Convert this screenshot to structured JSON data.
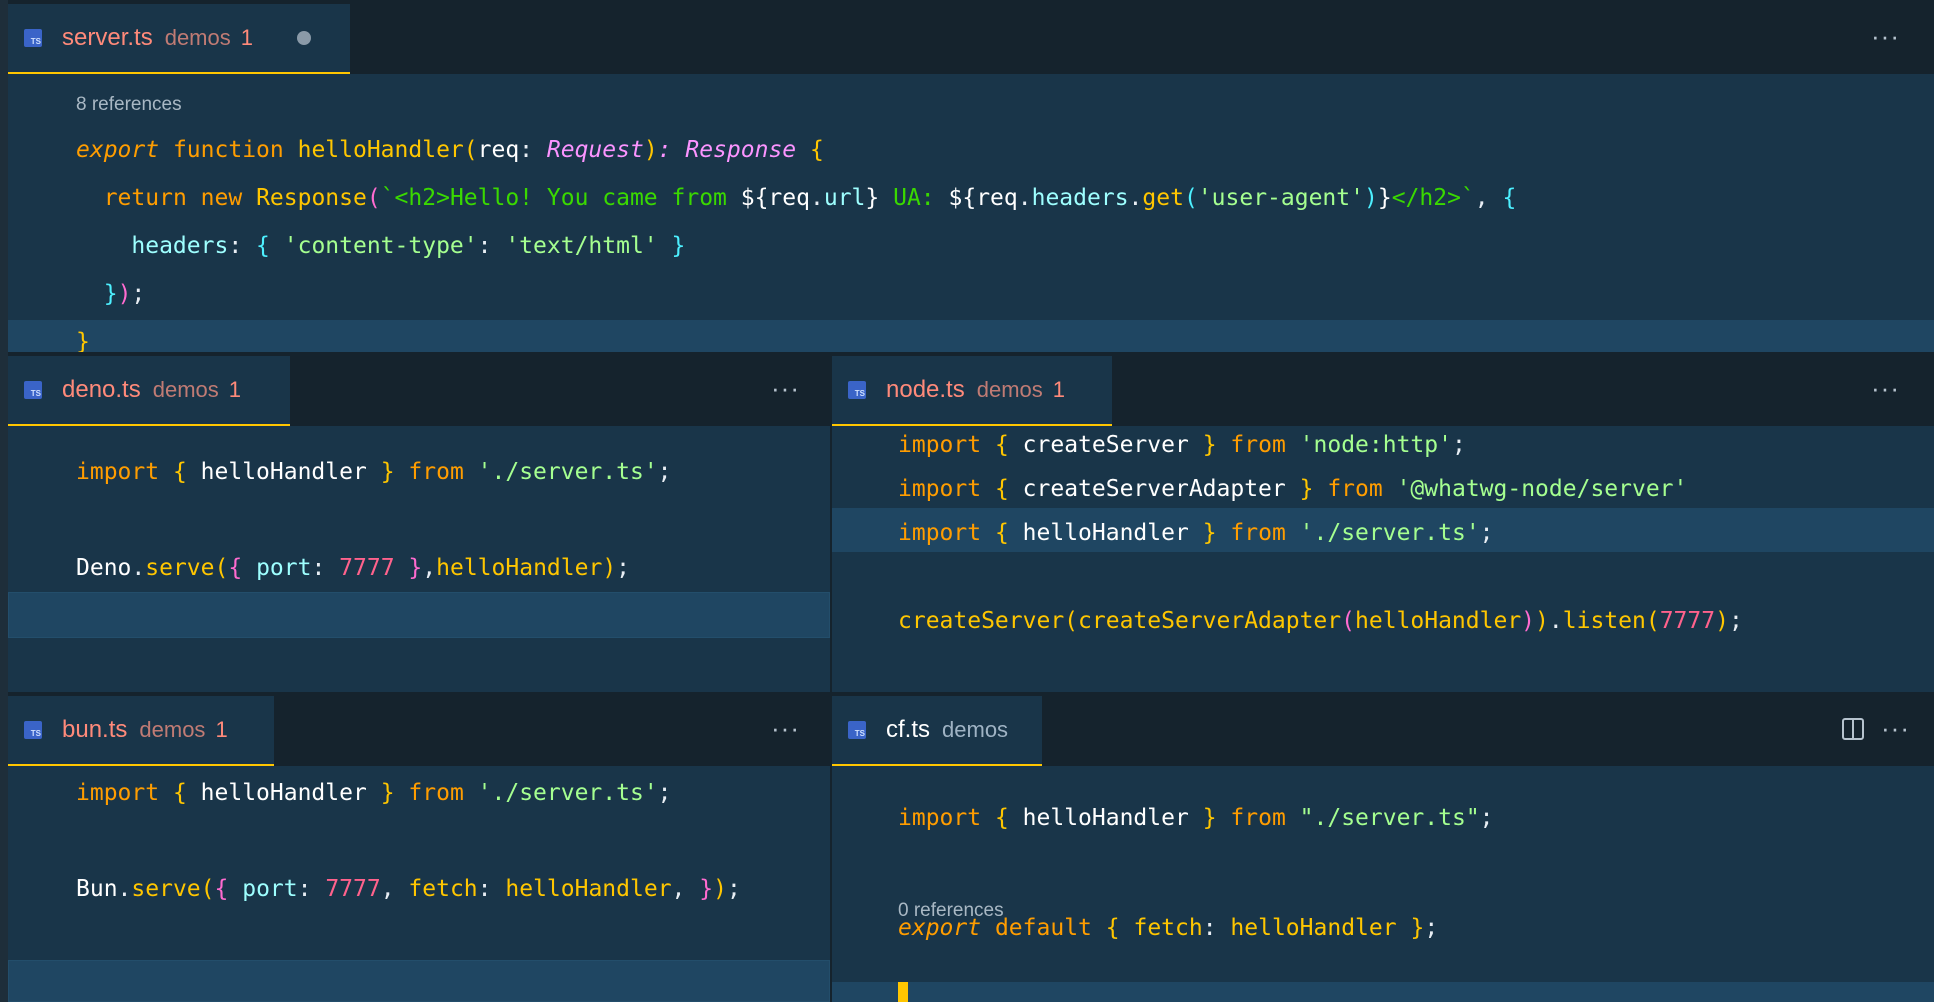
{
  "panes": {
    "server": {
      "tab": {
        "name": "server.ts",
        "folder": "demos",
        "count": "1"
      },
      "ref_top": "8 references",
      "lines": [
        [
          [
            "kwi",
            "export"
          ],
          [
            "plain",
            " "
          ],
          [
            "kw",
            "function"
          ],
          [
            "plain",
            " "
          ],
          [
            "fn",
            "helloHandler"
          ],
          [
            "br",
            "("
          ],
          [
            "plain",
            "req"
          ],
          [
            "punc",
            ": "
          ],
          [
            "ty",
            "Request"
          ],
          [
            "br",
            ")"
          ],
          [
            "ty",
            ": Response"
          ],
          [
            "plain",
            " "
          ],
          [
            "br",
            "{"
          ]
        ],
        [
          [
            "plain",
            "  "
          ],
          [
            "kw",
            "return"
          ],
          [
            "plain",
            " "
          ],
          [
            "kw",
            "new"
          ],
          [
            "plain",
            " "
          ],
          [
            "fn",
            "Response"
          ],
          [
            "br2",
            "("
          ],
          [
            "tpl",
            "`<h2>Hello! You came from "
          ],
          [
            "plain",
            "${req"
          ],
          [
            "punc",
            "."
          ],
          [
            "prop",
            "url"
          ],
          [
            "plain",
            "}"
          ],
          [
            "tpl",
            " UA: "
          ],
          [
            "plain",
            "${req"
          ],
          [
            "punc",
            "."
          ],
          [
            "prop",
            "headers"
          ],
          [
            "punc",
            "."
          ],
          [
            "fn",
            "get"
          ],
          [
            "br3",
            "("
          ],
          [
            "str",
            "'user-agent'"
          ],
          [
            "br3",
            ")"
          ],
          [
            "plain",
            "}"
          ],
          [
            "tpl",
            "</h2>`"
          ],
          [
            "punc",
            ", "
          ],
          [
            "br3",
            "{"
          ]
        ],
        [
          [
            "plain",
            "    "
          ],
          [
            "prop",
            "headers"
          ],
          [
            "punc",
            ": "
          ],
          [
            "br3",
            "{"
          ],
          [
            "plain",
            " "
          ],
          [
            "str",
            "'content-type'"
          ],
          [
            "punc",
            ": "
          ],
          [
            "str",
            "'text/html'"
          ],
          [
            "plain",
            " "
          ],
          [
            "br3",
            "}"
          ]
        ],
        [
          [
            "plain",
            "  "
          ],
          [
            "br3",
            "}"
          ],
          [
            "br2",
            ")"
          ],
          [
            "punc",
            ";"
          ]
        ],
        [
          [
            "br",
            "}"
          ]
        ]
      ]
    },
    "deno": {
      "tab": {
        "name": "deno.ts",
        "folder": "demos",
        "count": "1"
      },
      "lines": [
        [
          [
            "kw",
            "import"
          ],
          [
            "plain",
            " "
          ],
          [
            "br",
            "{"
          ],
          [
            "plain",
            " helloHandler "
          ],
          [
            "br",
            "}"
          ],
          [
            "plain",
            " "
          ],
          [
            "kw",
            "from"
          ],
          [
            "plain",
            " "
          ],
          [
            "str",
            "'./server.ts'"
          ],
          [
            "punc",
            ";"
          ]
        ],
        [],
        [
          [
            "plain",
            "Deno"
          ],
          [
            "punc",
            "."
          ],
          [
            "fn",
            "serve"
          ],
          [
            "br",
            "("
          ],
          [
            "br2",
            "{"
          ],
          [
            "plain",
            " "
          ],
          [
            "prop",
            "port"
          ],
          [
            "punc",
            ": "
          ],
          [
            "num",
            "7777"
          ],
          [
            "plain",
            " "
          ],
          [
            "br2",
            "}"
          ],
          [
            "punc",
            ","
          ],
          [
            "fn",
            "helloHandler"
          ],
          [
            "br",
            ")"
          ],
          [
            "punc",
            ";"
          ]
        ]
      ]
    },
    "node": {
      "tab": {
        "name": "node.ts",
        "folder": "demos",
        "count": "1"
      },
      "lines": [
        [
          [
            "kw",
            "import"
          ],
          [
            "plain",
            " "
          ],
          [
            "br",
            "{"
          ],
          [
            "plain",
            " createServer "
          ],
          [
            "br",
            "}"
          ],
          [
            "plain",
            " "
          ],
          [
            "kw",
            "from"
          ],
          [
            "plain",
            " "
          ],
          [
            "str",
            "'node:http'"
          ],
          [
            "punc",
            ";"
          ]
        ],
        [
          [
            "kw",
            "import"
          ],
          [
            "plain",
            " "
          ],
          [
            "br",
            "{"
          ],
          [
            "plain",
            " createServerAdapter "
          ],
          [
            "br",
            "}"
          ],
          [
            "plain",
            " "
          ],
          [
            "kw",
            "from"
          ],
          [
            "plain",
            " "
          ],
          [
            "str",
            "'@whatwg-node/server'"
          ]
        ],
        [
          [
            "kw",
            "import"
          ],
          [
            "plain",
            " "
          ],
          [
            "br",
            "{"
          ],
          [
            "plain",
            " helloHandler "
          ],
          [
            "br",
            "}"
          ],
          [
            "plain",
            " "
          ],
          [
            "kw",
            "from"
          ],
          [
            "plain",
            " "
          ],
          [
            "str",
            "'./server.ts'"
          ],
          [
            "punc",
            ";"
          ]
        ],
        [],
        [
          [
            "fn",
            "createServer"
          ],
          [
            "br",
            "("
          ],
          [
            "fn",
            "createServerAdapter"
          ],
          [
            "br2",
            "("
          ],
          [
            "fn",
            "helloHandler"
          ],
          [
            "br2",
            ")"
          ],
          [
            "br",
            ")"
          ],
          [
            "punc",
            "."
          ],
          [
            "fn",
            "listen"
          ],
          [
            "br",
            "("
          ],
          [
            "num",
            "7777"
          ],
          [
            "br",
            ")"
          ],
          [
            "punc",
            ";"
          ]
        ]
      ]
    },
    "bun": {
      "tab": {
        "name": "bun.ts",
        "folder": "demos",
        "count": "1"
      },
      "lines": [
        [
          [
            "kw",
            "import"
          ],
          [
            "plain",
            " "
          ],
          [
            "br",
            "{"
          ],
          [
            "plain",
            " helloHandler "
          ],
          [
            "br",
            "}"
          ],
          [
            "plain",
            " "
          ],
          [
            "kw",
            "from"
          ],
          [
            "plain",
            " "
          ],
          [
            "str",
            "'./server.ts'"
          ],
          [
            "punc",
            ";"
          ]
        ],
        [],
        [
          [
            "plain",
            "Bun"
          ],
          [
            "punc",
            "."
          ],
          [
            "fn",
            "serve"
          ],
          [
            "br",
            "("
          ],
          [
            "br2",
            "{"
          ],
          [
            "plain",
            " "
          ],
          [
            "prop",
            "port"
          ],
          [
            "punc",
            ": "
          ],
          [
            "num",
            "7777"
          ],
          [
            "punc",
            ", "
          ],
          [
            "fn",
            "fetch"
          ],
          [
            "punc",
            ": "
          ],
          [
            "fn",
            "helloHandler"
          ],
          [
            "punc",
            ", "
          ],
          [
            "br2",
            "}"
          ],
          [
            "br",
            ")"
          ],
          [
            "punc",
            ";"
          ]
        ]
      ]
    },
    "cf": {
      "tab": {
        "name": "cf.ts",
        "folder": "demos"
      },
      "ref": "0 references",
      "lines": [
        [
          [
            "kw",
            "import"
          ],
          [
            "plain",
            " "
          ],
          [
            "br",
            "{"
          ],
          [
            "plain",
            " helloHandler "
          ],
          [
            "br",
            "}"
          ],
          [
            "plain",
            " "
          ],
          [
            "kw",
            "from"
          ],
          [
            "plain",
            " "
          ],
          [
            "str",
            "\"./server.ts\""
          ],
          [
            "punc",
            ";"
          ]
        ],
        [],
        [
          [
            "kwi",
            "export"
          ],
          [
            "plain",
            " "
          ],
          [
            "kw",
            "default"
          ],
          [
            "plain",
            " "
          ],
          [
            "br",
            "{"
          ],
          [
            "plain",
            " "
          ],
          [
            "fn",
            "fetch"
          ],
          [
            "punc",
            ": "
          ],
          [
            "fn",
            "helloHandler"
          ],
          [
            "plain",
            " "
          ],
          [
            "br",
            "}"
          ],
          [
            "punc",
            ";"
          ]
        ]
      ]
    }
  },
  "icons": {
    "more": "more-actions-icon",
    "split": "split-editor-icon",
    "file": "typescript-file-icon"
  },
  "colors": {
    "background": "#193549",
    "accent": "#ffc600"
  }
}
